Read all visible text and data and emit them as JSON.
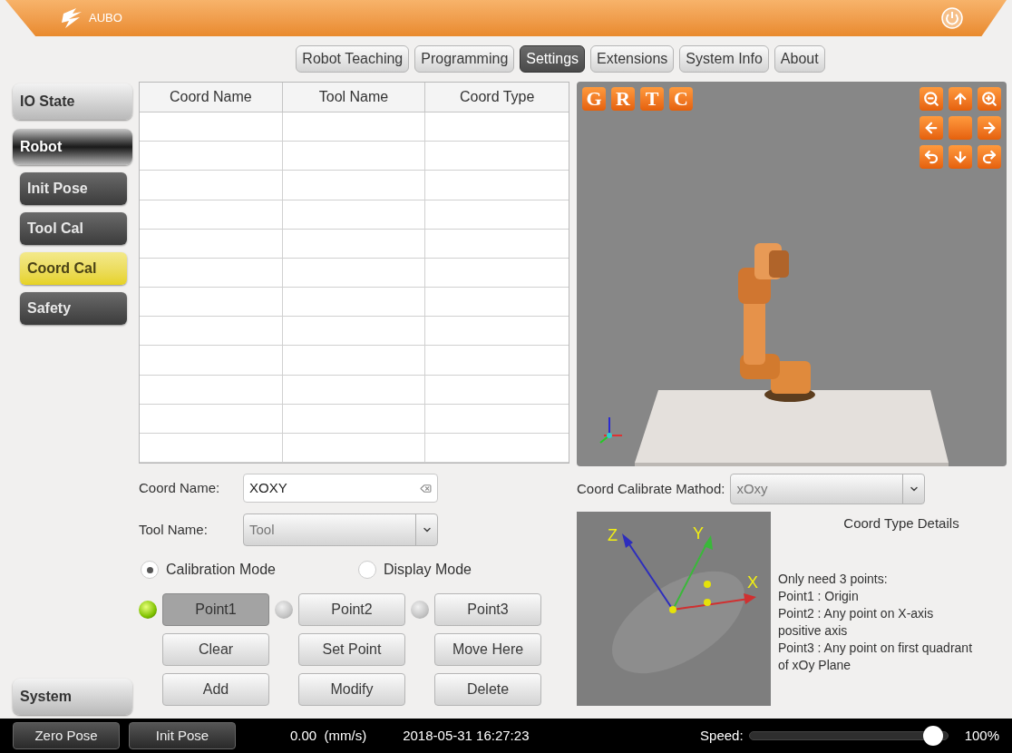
{
  "header": {
    "logo_text": "AUBO"
  },
  "tabs": [
    {
      "label": "Robot Teaching",
      "selected": false
    },
    {
      "label": "Programming",
      "selected": false
    },
    {
      "label": "Settings",
      "selected": true
    },
    {
      "label": "Extensions",
      "selected": false
    },
    {
      "label": "System Info",
      "selected": false
    },
    {
      "label": "About",
      "selected": false
    }
  ],
  "sidebar": {
    "items": [
      {
        "label": "IO State",
        "selected": false
      },
      {
        "label": "Robot",
        "selected": true,
        "children": [
          {
            "label": "Init Pose",
            "selected": false
          },
          {
            "label": "Tool Cal",
            "selected": false
          },
          {
            "label": "Coord Cal",
            "selected": true
          },
          {
            "label": "Safety",
            "selected": false
          }
        ]
      }
    ],
    "bottom_item": {
      "label": "System",
      "selected": false
    }
  },
  "table": {
    "columns": [
      "Coord Name",
      "Tool Name",
      "Coord Type"
    ]
  },
  "view": {
    "view_buttons": [
      "G",
      "R",
      "T",
      "C"
    ]
  },
  "form": {
    "coord_name": {
      "label": "Coord Name:",
      "value": "XOXY"
    },
    "tool_name": {
      "label": "Tool Name:",
      "value": "Tool"
    },
    "modes": [
      {
        "label": "Calibration Mode",
        "selected": true
      },
      {
        "label": "Display Mode",
        "selected": false
      }
    ],
    "points": [
      {
        "label": "Point1",
        "selected": true,
        "led_on": true
      },
      {
        "label": "Point2",
        "selected": false,
        "led_on": false
      },
      {
        "label": "Point3",
        "selected": false,
        "led_on": false
      }
    ],
    "actions": [
      "Clear",
      "Set Point",
      "Move Here",
      "Add",
      "Modify",
      "Delete"
    ]
  },
  "calibration": {
    "method_label": "Coord Calibrate Mathod:",
    "method_value": "xOxy",
    "details_title": "Coord Type Details",
    "details": [
      "Only need 3 points:",
      "Point1 : Origin",
      "Point2 : Any point on X-axis positive axis",
      "Point3 : Any point on first quadrant of xOy Plane"
    ],
    "axis_labels": [
      "Z",
      "Y",
      "X"
    ]
  },
  "status_bar": {
    "buttons": [
      "Zero Pose",
      "Init Pose"
    ],
    "velocity": "0.00  (mm/s)",
    "datetime": "2018-05-31 16:27:23",
    "speed": {
      "label": "Speed:",
      "level": 0.97,
      "reading": "100%"
    }
  }
}
